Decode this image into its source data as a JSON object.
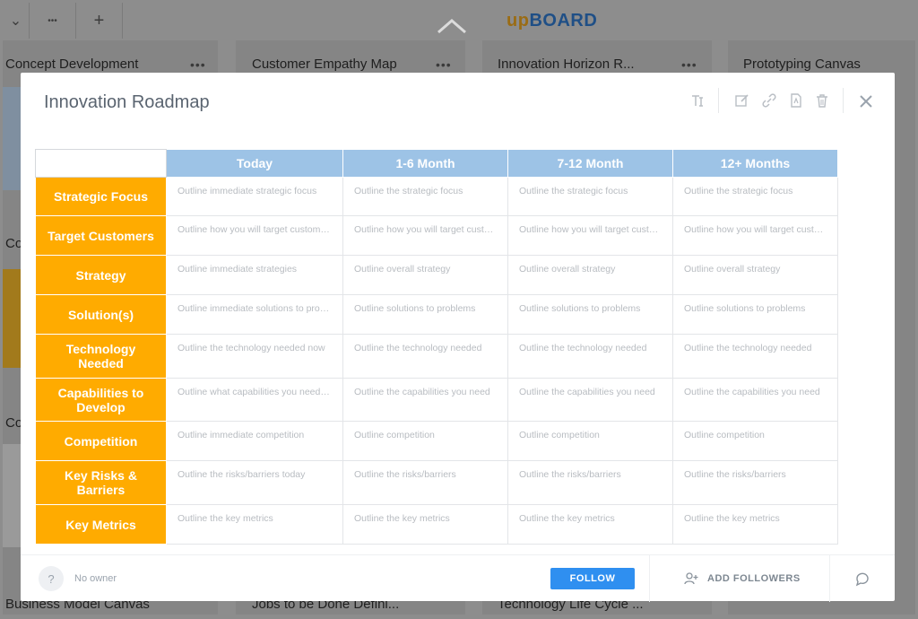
{
  "app": {
    "logo_up": "up",
    "logo_board": "BOARD"
  },
  "topbar": {
    "chevron": "⌄",
    "more": "•••",
    "add": "+"
  },
  "background": {
    "cards_top": [
      "Concept Development",
      "Customer Empathy Map",
      "Innovation Horizon R...",
      "Prototyping Canvas"
    ],
    "cards_bottom": [
      "Business Model Canvas",
      "Jobs to be Done Defini...",
      "Technology Life Cycle ..."
    ],
    "side_labels": [
      "Co",
      "Co"
    ],
    "dots": "•••"
  },
  "modal": {
    "title": "Innovation Roadmap",
    "tools": [
      "text-size-icon",
      "edit-icon",
      "link-icon",
      "pdf-icon",
      "trash-icon"
    ]
  },
  "table": {
    "columns": [
      "Today",
      "1-6 Month",
      "7-12 Month",
      "12+ Months"
    ],
    "rows": [
      {
        "label": "Strategic Focus",
        "cells": [
          "Outline immediate strategic focus",
          "Outline the strategic focus",
          "Outline the strategic focus",
          "Outline the strategic focus"
        ]
      },
      {
        "label": "Target Customers",
        "cells": [
          "Outline how you will target custome...",
          "Outline how you will target custo...",
          "Outline how you will target custo...",
          "Outline how you will target custo..."
        ]
      },
      {
        "label": "Strategy",
        "cells": [
          "Outline immediate strategies",
          "Outline overall strategy",
          "Outline overall strategy",
          "Outline overall strategy"
        ]
      },
      {
        "label": "Solution(s)",
        "cells": [
          "Outline immediate solutions to prob...",
          "Outline solutions to problems",
          "Outline solutions to problems",
          "Outline solutions to problems"
        ]
      },
      {
        "label": "Technology Needed",
        "cells": [
          "Outline the technology needed now",
          "Outline the technology needed",
          "Outline the technology needed",
          "Outline the technology needed"
        ]
      },
      {
        "label": "Capabilities to Develop",
        "cells": [
          "Outline what capabilities you need n...",
          "Outline the capabilities you need",
          "Outline the capabilities you need",
          "Outline the capabilities you need"
        ]
      },
      {
        "label": "Competition",
        "cells": [
          "Outline immediate competition",
          "Outline competition",
          "Outline competition",
          "Outline competition"
        ]
      },
      {
        "label": "Key Risks & Barriers",
        "cells": [
          "Outline the risks/barriers today",
          "Outline the risks/barriers",
          "Outline the risks/barriers",
          "Outline the risks/barriers"
        ]
      },
      {
        "label": "Key Metrics",
        "cells": [
          "Outline the key metrics",
          "Outline the key metrics",
          "Outline the key metrics",
          "Outline the key metrics"
        ]
      }
    ]
  },
  "footer": {
    "owner_icon": "?",
    "owner_text": "No owner",
    "follow_label": "FOLLOW",
    "add_followers_label": "ADD FOLLOWERS"
  },
  "colors": {
    "header_blue": "#9dc3e6",
    "row_orange": "#ffab00",
    "follow_blue": "#2f8ff0"
  }
}
